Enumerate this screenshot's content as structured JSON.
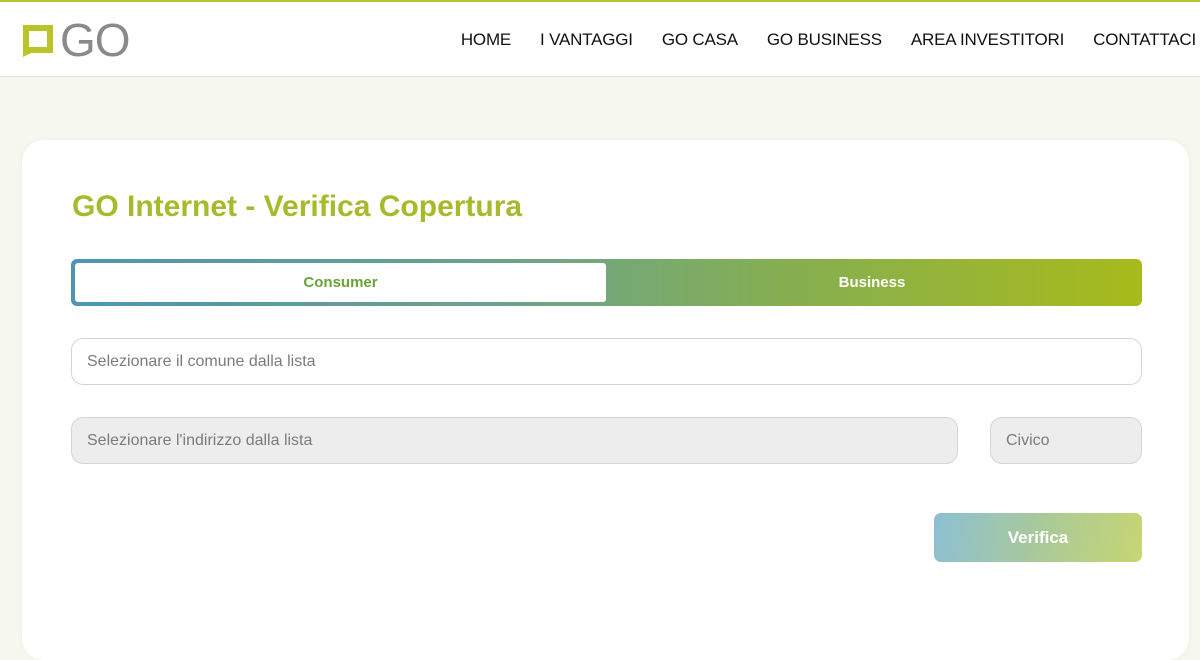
{
  "header": {
    "logo_text": "GO",
    "logo_icon": "speech-square-icon",
    "nav": [
      {
        "label": "HOME"
      },
      {
        "label": "I VANTAGGI"
      },
      {
        "label": "GO CASA"
      },
      {
        "label": "GO BUSINESS"
      },
      {
        "label": "AREA INVESTITORI"
      },
      {
        "label": "CONTATTACI"
      }
    ]
  },
  "form": {
    "title": "GO Internet - Verifica Copertura",
    "tabs": [
      {
        "label": "Consumer",
        "selected": true
      },
      {
        "label": "Business",
        "selected": false
      }
    ],
    "comune": {
      "value": "",
      "placeholder": "Selezionare il comune dalla lista"
    },
    "indirizzo": {
      "value": "",
      "placeholder": "Selezionare l'indirizzo dalla lista"
    },
    "civico": {
      "value": "",
      "placeholder": "Civico"
    },
    "submit_label": "Verifica"
  },
  "colors": {
    "brand_green": "#a8ba2c",
    "tab_active_text": "#6aa33a",
    "gradient_start": "#4d95b3",
    "gradient_end": "#a8ba1b",
    "page_background": "#f6f7ee"
  }
}
